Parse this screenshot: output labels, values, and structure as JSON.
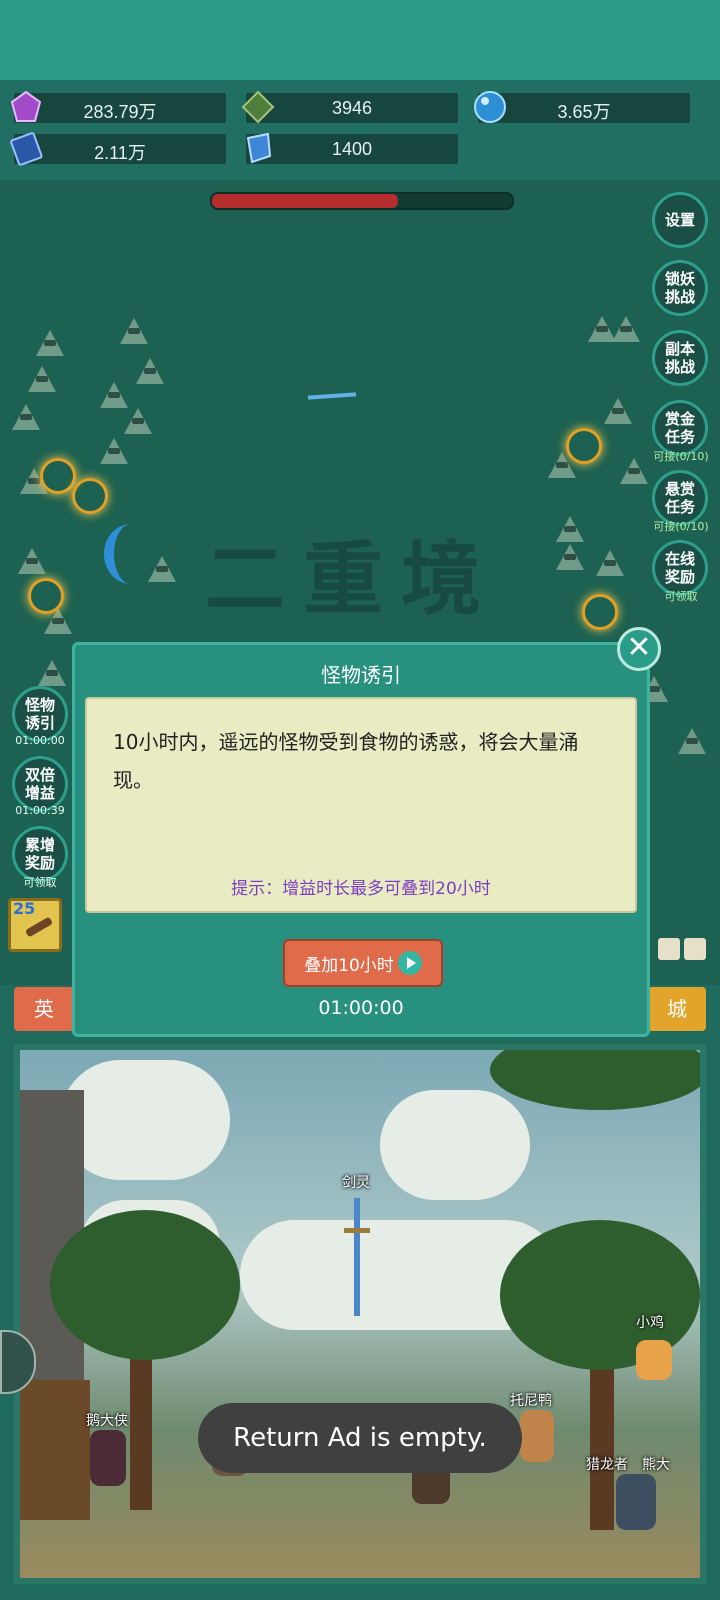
{
  "resources": [
    {
      "name": "gem-icon",
      "value": "283.79万",
      "color": "#a24bc8"
    },
    {
      "name": "jade-icon",
      "value": "3946",
      "color": "#4f7d3c"
    },
    {
      "name": "orb-icon",
      "value": "3.65万",
      "color": "#2f8fd4"
    },
    {
      "name": "book-icon",
      "value": "2.11万",
      "color": "#2a58a8"
    },
    {
      "name": "crystal-icon",
      "value": "1400",
      "color": "#3f86d6"
    }
  ],
  "boss_hp_fraction": 0.62,
  "right_menu": [
    {
      "label": "设置",
      "sub": ""
    },
    {
      "label": "锁妖\n挑战",
      "sub": ""
    },
    {
      "label": "副本\n挑战",
      "sub": ""
    },
    {
      "label": "赏金\n任务",
      "sub": "可接(0/10)"
    },
    {
      "label": "悬赏\n任务",
      "sub": "可接(0/10)"
    },
    {
      "label": "在线\n奖励",
      "sub": "可领取"
    }
  ],
  "left_menu": [
    {
      "label": "怪物\n诱引",
      "sub": "01:00:00"
    },
    {
      "label": "双倍\n增益",
      "sub": "01:00:39"
    },
    {
      "label": "累增\n奖励",
      "sub": "可领取"
    }
  ],
  "watermark": "二重境",
  "level_badge": "25",
  "modal": {
    "title": "怪物诱引",
    "description": "10小时内，遥远的怪物受到食物的诱惑，将会大量涌现。",
    "hint": "提示：增益时长最多可叠到20小时",
    "button_label": "叠加10小时",
    "timer": "01:00:00"
  },
  "tabs": {
    "left": "英",
    "right": "城"
  },
  "scene_names": {
    "sword": "剑灵",
    "chicken": "小鸡",
    "goose": "鹅大侠",
    "duck": "托尼鸭",
    "hunter": "猎龙者",
    "bear": "熊大"
  },
  "toast": "Return Ad is empty."
}
